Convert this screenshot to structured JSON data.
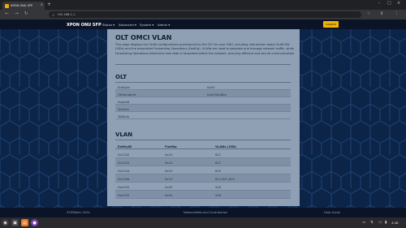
{
  "browser": {
    "tab_title": "XPON ONU SFP",
    "url": "192.168.1.1",
    "tab_close": "×",
    "new_tab": "+",
    "win_min": "–",
    "win_max": "□",
    "win_close": "×",
    "back": "←",
    "forward": "→",
    "reload": "↻",
    "lock": "⚠",
    "star": "☆",
    "ext": "⬇",
    "menu": "⋮"
  },
  "app": {
    "brand": "XPON ONU SFP",
    "menu": [
      "Status ▾",
      "Advanced ▾",
      "System ▾",
      "Admin ▾"
    ],
    "logout": "Logout"
  },
  "page": {
    "title": "OLT OMCI VLAN",
    "description": "This page displays the VLAN configurations provisioned by the OLT for your ONU, including information about VLAN IDs (VIDs) and the associated Forwarding Operations (FwdOp). VLANs are used to separate and manage network traffic, while Forwarding Operations determine how data is forwarded within the network, ensuring efficient and secure communication."
  },
  "olt": {
    "heading": "OLT",
    "rows": [
      {
        "key": "EntityId",
        "value": "0x00"
      },
      {
        "key": "OltVendorId",
        "value": "0xd15d282e"
      },
      {
        "key": "EquipId",
        "value": ""
      },
      {
        "key": "Version",
        "value": ""
      },
      {
        "key": "ToDInfo",
        "value": ""
      }
    ]
  },
  "vlan": {
    "heading": "VLAN",
    "columns": [
      "EntityID",
      "FwdOp",
      "VLANs (VID)"
    ],
    "rows": [
      [
        "0x1202",
        "0x10",
        "621"
      ],
      [
        "0x1203",
        "0x10",
        "621"
      ],
      [
        "0x1204",
        "0x10",
        "622"
      ],
      [
        "0x120b",
        "0x10",
        "621,621,622"
      ],
      [
        "0xe100",
        "0x02",
        "200"
      ],
      [
        "0xe100",
        "0x02",
        "200"
      ]
    ]
  },
  "footer": {
    "left": "ZYZFABriv 2024",
    "center": "NetworkWeb and Contribution",
    "right": "Help Guide"
  },
  "taskbar": {
    "clock": "4:48"
  }
}
